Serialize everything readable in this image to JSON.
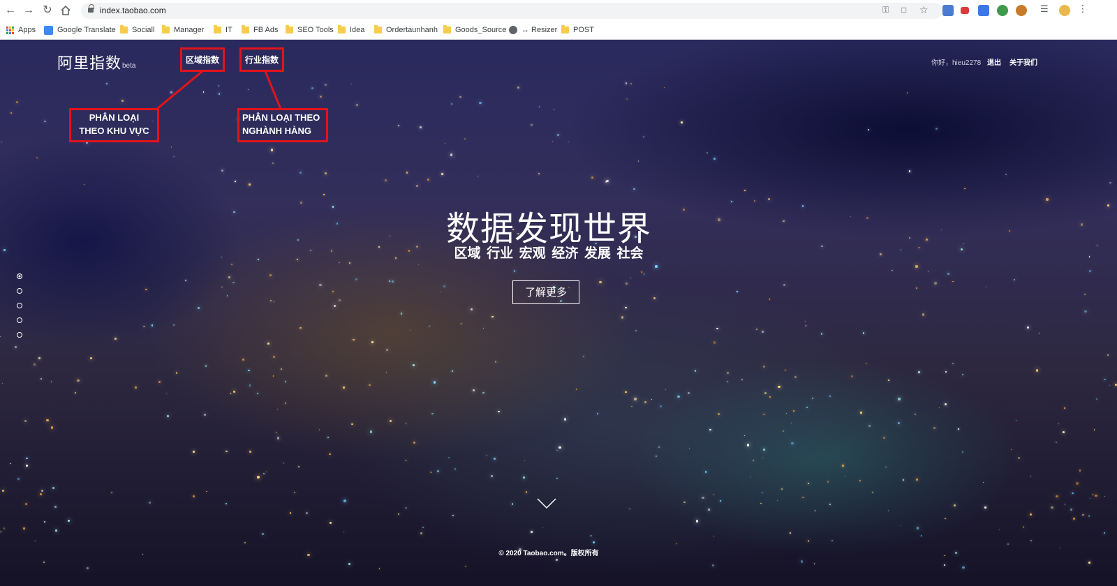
{
  "browser": {
    "url": "index.taobao.com",
    "bookmarks": [
      {
        "label": "Apps",
        "icon": "apps-grid-icon"
      },
      {
        "label": "Google Translate",
        "icon": "google-translate-icon"
      },
      {
        "label": "Sociall",
        "icon": "folder-icon"
      },
      {
        "label": "Manager",
        "icon": "folder-icon"
      },
      {
        "label": "IT",
        "icon": "folder-icon"
      },
      {
        "label": "FB Ads",
        "icon": "folder-icon"
      },
      {
        "label": "SEO Tools",
        "icon": "folder-icon"
      },
      {
        "label": "Idea",
        "icon": "folder-icon"
      },
      {
        "label": "Ordertaunhanh",
        "icon": "folder-icon"
      },
      {
        "label": "Goods_Source",
        "icon": "folder-icon"
      },
      {
        "label": "↔ Resizer",
        "icon": "globe-icon"
      },
      {
        "label": "POST",
        "icon": "folder-icon"
      }
    ]
  },
  "site": {
    "logo": "阿里指数",
    "beta": "beta",
    "nav": {
      "region": "区域指数",
      "industry": "行业指数"
    },
    "user": {
      "greeting": "你好，hieu2278",
      "logout": "退出",
      "about": "关于我们"
    },
    "hero": {
      "title": "数据发现世界",
      "subtitle": "区域 行业 宏观 经济 发展 社会",
      "button": "了解更多"
    },
    "footer": "© 2020 Taobao.com。版权所有",
    "slides": {
      "count": 5,
      "active": 1
    }
  },
  "annotations": {
    "region_line1": "PHÂN LOẠI",
    "region_line2": "THEO KHU VỰC",
    "industry_line1": "PHÂN LOẠI THEO",
    "industry_line2": "NGHÀNH HÀNG"
  },
  "colors": {
    "annotation_red": "#e3131b",
    "hero_text": "#ffffff",
    "night_sky": "#2a2a5e"
  }
}
